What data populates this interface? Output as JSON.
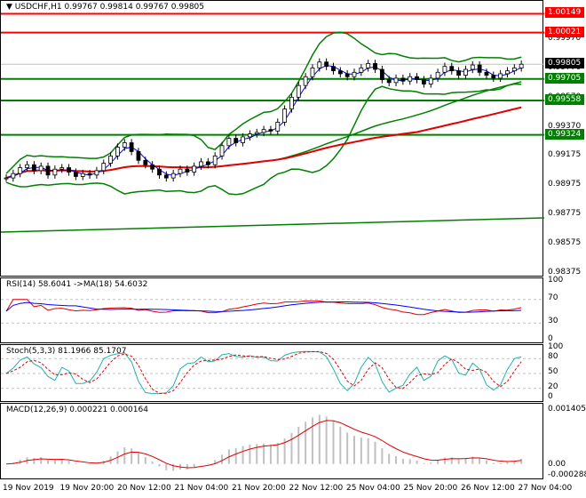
{
  "header": {
    "symbol": "USDCHF,H1",
    "open": "0.99767",
    "high": "0.99814",
    "low": "0.99767",
    "close": "0.99805"
  },
  "price_axis": [
    "0.99970",
    "0.99770",
    "0.99570",
    "0.99370",
    "0.99175",
    "0.98975",
    "0.98775",
    "0.98575",
    "0.98375"
  ],
  "levels": [
    {
      "value": "1.00149",
      "color": "#ff0000"
    },
    {
      "value": "1.00021",
      "color": "#ff0000"
    },
    {
      "value": "0.99805",
      "color": "#000000"
    },
    {
      "value": "0.99705",
      "color": "#008000"
    },
    {
      "value": "0.99558",
      "color": "#008000"
    },
    {
      "value": "0.99324",
      "color": "#008000"
    }
  ],
  "rsi": {
    "title": "RSI(14) 58.6041  ->MA(18) 54.6032",
    "axis": [
      "100",
      "70",
      "30",
      "0"
    ]
  },
  "stoch": {
    "title": "Stoch(5,3,3) 81.1966 85.1707",
    "axis": [
      "100",
      "80",
      "50",
      "20",
      "0"
    ]
  },
  "macd": {
    "title": "MACD(12,26,9) 0.000221 0.000164",
    "axis": [
      "0.001405",
      "0.00",
      "-0.000288"
    ]
  },
  "time_axis": [
    "19 Nov 2019",
    "19 Nov 20:00",
    "20 Nov 12:00",
    "21 Nov 04:00",
    "21 Nov 20:00",
    "22 Nov 12:00",
    "25 Nov 04:00",
    "25 Nov 20:00",
    "26 Nov 12:00",
    "27 Nov 04:00"
  ],
  "chart_data": {
    "type": "candlestick",
    "closes": [
      0.9903,
      0.9906,
      0.991,
      0.9912,
      0.9908,
      0.9911,
      0.9905,
      0.9909,
      0.991,
      0.9907,
      0.9904,
      0.9906,
      0.9905,
      0.9908,
      0.9913,
      0.9918,
      0.9924,
      0.9927,
      0.9921,
      0.9915,
      0.9912,
      0.9909,
      0.9905,
      0.9903,
      0.9906,
      0.9909,
      0.9907,
      0.9911,
      0.9914,
      0.9912,
      0.9918,
      0.9925,
      0.993,
      0.9927,
      0.9931,
      0.9933,
      0.9934,
      0.9936,
      0.9935,
      0.9941,
      0.995,
      0.9958,
      0.9966,
      0.9972,
      0.9978,
      0.9982,
      0.9979,
      0.9976,
      0.9974,
      0.9972,
      0.9975,
      0.9978,
      0.9981,
      0.9977,
      0.997,
      0.9968,
      0.9971,
      0.9969,
      0.9972,
      0.997,
      0.9967,
      0.9971,
      0.9975,
      0.9979,
      0.9976,
      0.9973,
      0.9977,
      0.998,
      0.9975,
      0.9973,
      0.9971,
      0.9974,
      0.9976,
      0.9978,
      0.99805
    ]
  }
}
